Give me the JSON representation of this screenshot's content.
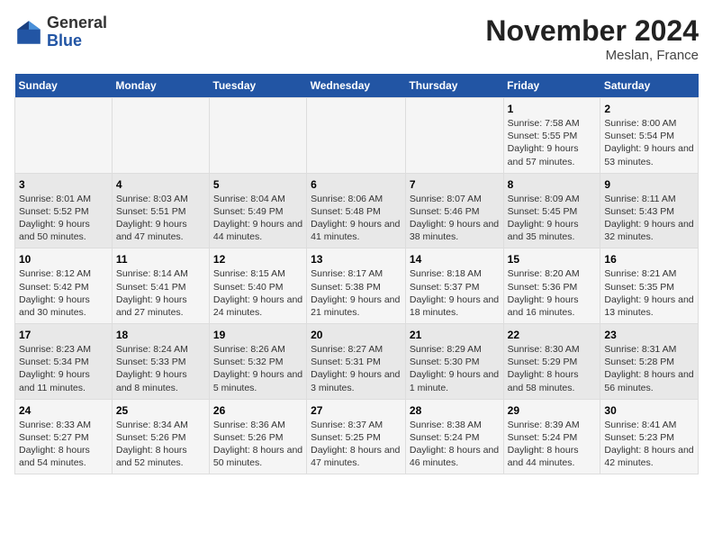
{
  "header": {
    "logo_general": "General",
    "logo_blue": "Blue",
    "month_title": "November 2024",
    "location": "Meslan, France"
  },
  "weekdays": [
    "Sunday",
    "Monday",
    "Tuesday",
    "Wednesday",
    "Thursday",
    "Friday",
    "Saturday"
  ],
  "rows": [
    [
      {
        "day": "",
        "info": ""
      },
      {
        "day": "",
        "info": ""
      },
      {
        "day": "",
        "info": ""
      },
      {
        "day": "",
        "info": ""
      },
      {
        "day": "",
        "info": ""
      },
      {
        "day": "1",
        "info": "Sunrise: 7:58 AM\nSunset: 5:55 PM\nDaylight: 9 hours and 57 minutes."
      },
      {
        "day": "2",
        "info": "Sunrise: 8:00 AM\nSunset: 5:54 PM\nDaylight: 9 hours and 53 minutes."
      }
    ],
    [
      {
        "day": "3",
        "info": "Sunrise: 8:01 AM\nSunset: 5:52 PM\nDaylight: 9 hours and 50 minutes."
      },
      {
        "day": "4",
        "info": "Sunrise: 8:03 AM\nSunset: 5:51 PM\nDaylight: 9 hours and 47 minutes."
      },
      {
        "day": "5",
        "info": "Sunrise: 8:04 AM\nSunset: 5:49 PM\nDaylight: 9 hours and 44 minutes."
      },
      {
        "day": "6",
        "info": "Sunrise: 8:06 AM\nSunset: 5:48 PM\nDaylight: 9 hours and 41 minutes."
      },
      {
        "day": "7",
        "info": "Sunrise: 8:07 AM\nSunset: 5:46 PM\nDaylight: 9 hours and 38 minutes."
      },
      {
        "day": "8",
        "info": "Sunrise: 8:09 AM\nSunset: 5:45 PM\nDaylight: 9 hours and 35 minutes."
      },
      {
        "day": "9",
        "info": "Sunrise: 8:11 AM\nSunset: 5:43 PM\nDaylight: 9 hours and 32 minutes."
      }
    ],
    [
      {
        "day": "10",
        "info": "Sunrise: 8:12 AM\nSunset: 5:42 PM\nDaylight: 9 hours and 30 minutes."
      },
      {
        "day": "11",
        "info": "Sunrise: 8:14 AM\nSunset: 5:41 PM\nDaylight: 9 hours and 27 minutes."
      },
      {
        "day": "12",
        "info": "Sunrise: 8:15 AM\nSunset: 5:40 PM\nDaylight: 9 hours and 24 minutes."
      },
      {
        "day": "13",
        "info": "Sunrise: 8:17 AM\nSunset: 5:38 PM\nDaylight: 9 hours and 21 minutes."
      },
      {
        "day": "14",
        "info": "Sunrise: 8:18 AM\nSunset: 5:37 PM\nDaylight: 9 hours and 18 minutes."
      },
      {
        "day": "15",
        "info": "Sunrise: 8:20 AM\nSunset: 5:36 PM\nDaylight: 9 hours and 16 minutes."
      },
      {
        "day": "16",
        "info": "Sunrise: 8:21 AM\nSunset: 5:35 PM\nDaylight: 9 hours and 13 minutes."
      }
    ],
    [
      {
        "day": "17",
        "info": "Sunrise: 8:23 AM\nSunset: 5:34 PM\nDaylight: 9 hours and 11 minutes."
      },
      {
        "day": "18",
        "info": "Sunrise: 8:24 AM\nSunset: 5:33 PM\nDaylight: 9 hours and 8 minutes."
      },
      {
        "day": "19",
        "info": "Sunrise: 8:26 AM\nSunset: 5:32 PM\nDaylight: 9 hours and 5 minutes."
      },
      {
        "day": "20",
        "info": "Sunrise: 8:27 AM\nSunset: 5:31 PM\nDaylight: 9 hours and 3 minutes."
      },
      {
        "day": "21",
        "info": "Sunrise: 8:29 AM\nSunset: 5:30 PM\nDaylight: 9 hours and 1 minute."
      },
      {
        "day": "22",
        "info": "Sunrise: 8:30 AM\nSunset: 5:29 PM\nDaylight: 8 hours and 58 minutes."
      },
      {
        "day": "23",
        "info": "Sunrise: 8:31 AM\nSunset: 5:28 PM\nDaylight: 8 hours and 56 minutes."
      }
    ],
    [
      {
        "day": "24",
        "info": "Sunrise: 8:33 AM\nSunset: 5:27 PM\nDaylight: 8 hours and 54 minutes."
      },
      {
        "day": "25",
        "info": "Sunrise: 8:34 AM\nSunset: 5:26 PM\nDaylight: 8 hours and 52 minutes."
      },
      {
        "day": "26",
        "info": "Sunrise: 8:36 AM\nSunset: 5:26 PM\nDaylight: 8 hours and 50 minutes."
      },
      {
        "day": "27",
        "info": "Sunrise: 8:37 AM\nSunset: 5:25 PM\nDaylight: 8 hours and 47 minutes."
      },
      {
        "day": "28",
        "info": "Sunrise: 8:38 AM\nSunset: 5:24 PM\nDaylight: 8 hours and 46 minutes."
      },
      {
        "day": "29",
        "info": "Sunrise: 8:39 AM\nSunset: 5:24 PM\nDaylight: 8 hours and 44 minutes."
      },
      {
        "day": "30",
        "info": "Sunrise: 8:41 AM\nSunset: 5:23 PM\nDaylight: 8 hours and 42 minutes."
      }
    ]
  ]
}
